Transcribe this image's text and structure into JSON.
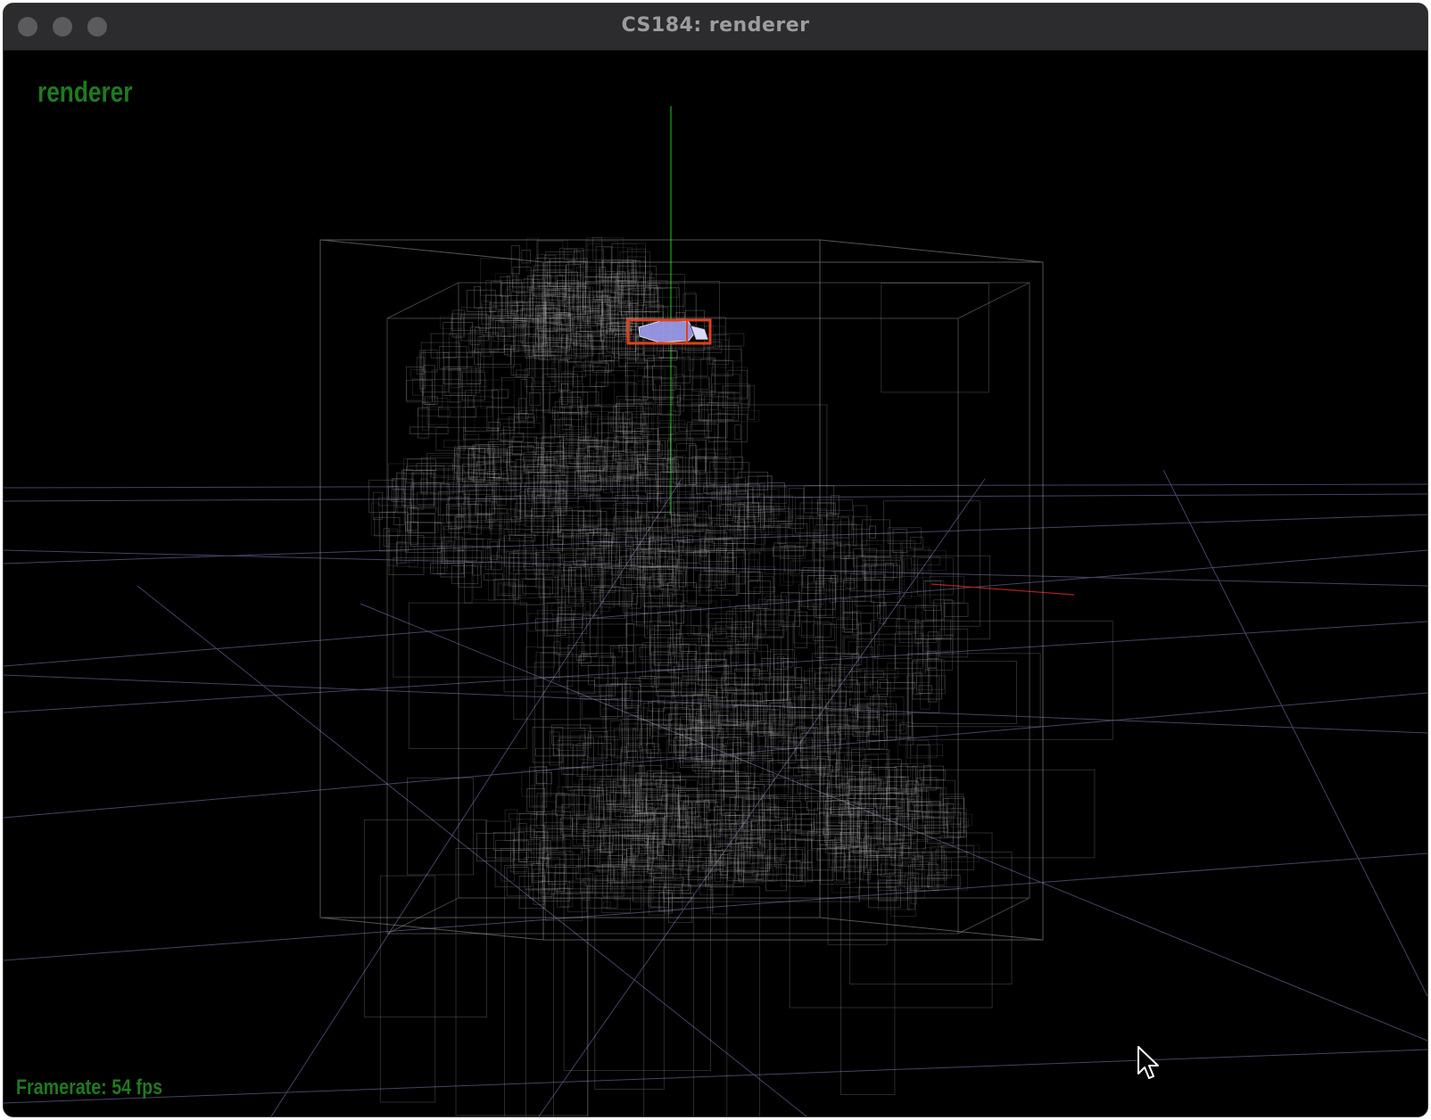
{
  "window": {
    "title": "CS184: renderer"
  },
  "overlay": {
    "app_label": "renderer",
    "framerate_text": "Framerate: 54 fps"
  },
  "colors": {
    "overlay_text": "#1f7a1f",
    "selection_box": "#e0401a",
    "selected_mesh": "#9a9ae8",
    "bvh_lines": "#bdbdbd",
    "grid_lines": "#5a5a8a",
    "y_axis": "#1fa81f",
    "x_axis": "#b02020"
  },
  "icons": {
    "close": "traffic-light-close-icon",
    "minimize": "traffic-light-minimize-icon",
    "zoom": "traffic-light-zoom-icon",
    "cursor": "mouse-pointer-icon"
  }
}
